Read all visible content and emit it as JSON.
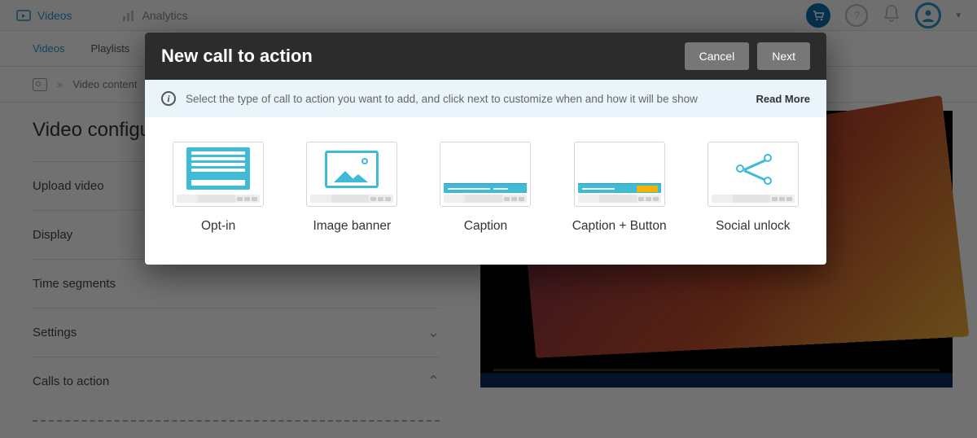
{
  "topnav": {
    "videos_label": "Videos",
    "analytics_label": "Analytics"
  },
  "subnav": {
    "videos": "Videos",
    "playlists": "Playlists"
  },
  "breadcrumb": {
    "text": "Video content",
    "sep": "»"
  },
  "page": {
    "title": "Video configur"
  },
  "sidebar": {
    "items": [
      {
        "label": "Upload video",
        "expandable": false
      },
      {
        "label": "Display",
        "expandable": true,
        "open": false
      },
      {
        "label": "Time segments",
        "expandable": false
      },
      {
        "label": "Settings",
        "expandable": true,
        "open": false
      },
      {
        "label": "Calls to action",
        "expandable": true,
        "open": true
      }
    ]
  },
  "modal": {
    "title": "New call to action",
    "cancel": "Cancel",
    "next": "Next",
    "info_text": "Select the type of call to action you want to add, and click next to customize when and how it will be show",
    "read_more": "Read More",
    "options": [
      {
        "label": "Opt-in"
      },
      {
        "label": "Image banner"
      },
      {
        "label": "Caption"
      },
      {
        "label": "Caption + Button"
      },
      {
        "label": "Social unlock"
      }
    ],
    "close": "×"
  }
}
